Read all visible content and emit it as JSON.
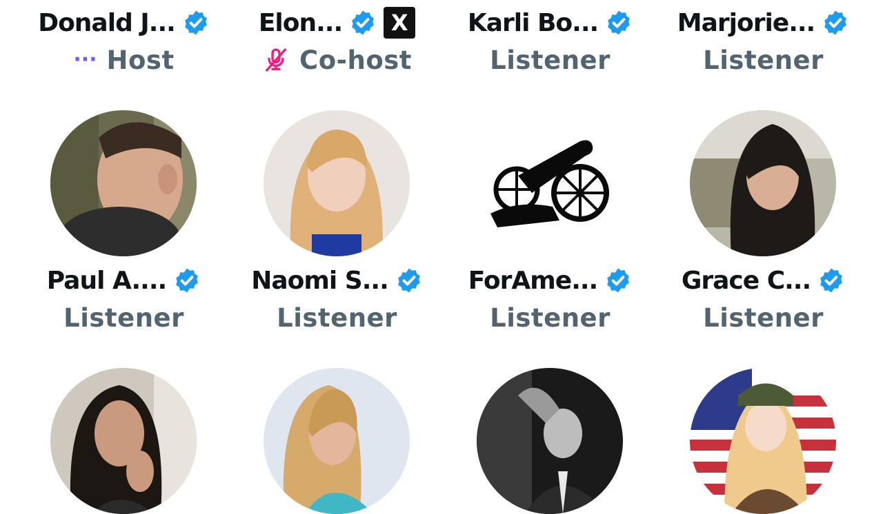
{
  "colors": {
    "verified": "#1d9bf0",
    "role_text": "#536471",
    "name_text": "#0f1419",
    "host_icon": "#7856ff",
    "mute_icon": "#f91880"
  },
  "participants": [
    {
      "name": "Donald J...",
      "role": "Host",
      "verified": true,
      "role_icon": "speaking-dots-icon",
      "role_icon_text": "···"
    },
    {
      "name": "Elon...",
      "role": "Co-host",
      "verified": true,
      "badge": "X",
      "role_icon": "mic-muted-icon"
    },
    {
      "name": "Karli Bo...",
      "role": "Listener",
      "verified": true
    },
    {
      "name": "Marjorie...",
      "role": "Listener",
      "verified": true
    },
    {
      "name": "Paul A....",
      "role": "Listener",
      "verified": true
    },
    {
      "name": "Naomi S...",
      "role": "Listener",
      "verified": true
    },
    {
      "name": "ForAme...",
      "role": "Listener",
      "verified": true
    },
    {
      "name": "Grace C...",
      "role": "Listener",
      "verified": true
    },
    {
      "name": "",
      "role": ""
    },
    {
      "name": "",
      "role": ""
    },
    {
      "name": "",
      "role": ""
    },
    {
      "name": "",
      "role": ""
    }
  ]
}
